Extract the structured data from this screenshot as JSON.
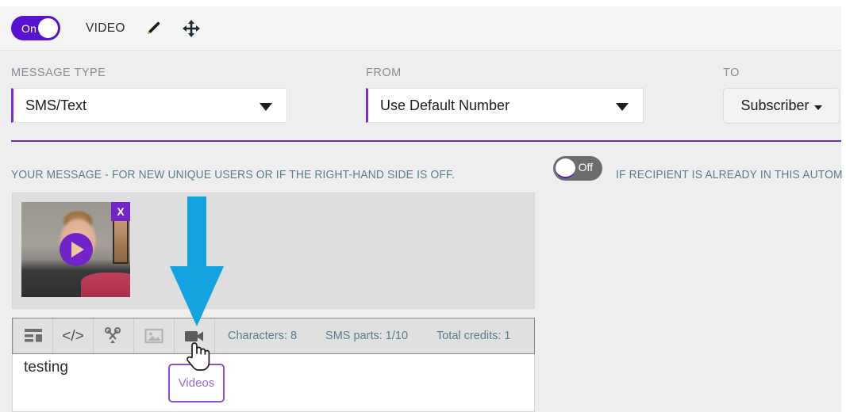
{
  "header": {
    "toggle": {
      "state_label": "On",
      "on": true
    },
    "title": "VIDEO",
    "edit_icon": "pencil-icon",
    "move_icon": "move-icon"
  },
  "fields": {
    "message_type": {
      "label": "MESSAGE TYPE",
      "value": "SMS/Text",
      "options": [
        "SMS/Text"
      ]
    },
    "from": {
      "label": "FROM",
      "value": "Use Default Number",
      "options": [
        "Use Default Number"
      ]
    },
    "to": {
      "label": "TO",
      "value": "Subscriber"
    }
  },
  "message_section": {
    "heading": "YOUR MESSAGE - FOR NEW UNIQUE USERS OR IF THE RIGHT-HAND SIDE IS OFF.",
    "recipient_toggle": {
      "state_label": "Off",
      "on": false
    },
    "recipient_heading": "IF RECIPIENT IS ALREADY IN THIS AUTOM",
    "attachment": {
      "close_label": "X",
      "play_icon": "play-icon"
    }
  },
  "toolbar": {
    "buttons": [
      {
        "name": "template-icon",
        "title": "Templates"
      },
      {
        "name": "code-icon",
        "title": "Code"
      },
      {
        "name": "link-icon",
        "title": "Links"
      },
      {
        "name": "image-icon",
        "title": "Images"
      },
      {
        "name": "video-icon",
        "title": "Videos"
      }
    ],
    "stats": [
      "Characters: 8",
      "SMS parts: 1/10",
      "Total credits: 1"
    ]
  },
  "editor": {
    "message_value": "testing"
  },
  "tooltip": {
    "label": "Videos"
  },
  "annotation": {
    "arrow_color": "#13a3e0"
  },
  "colors": {
    "brand_purple": "#5712d4",
    "divider_purple": "#6a2bbd",
    "muted_teal": "#5a7d8c",
    "label_gray": "#8b8b95"
  }
}
